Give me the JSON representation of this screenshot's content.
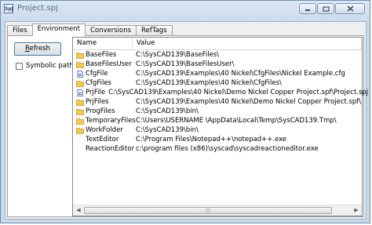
{
  "window": {
    "title": "Project.spj",
    "app_icon": "SpJ"
  },
  "tabs": [
    "Files",
    "Environment",
    "Conversions",
    "RefTags"
  ],
  "left": {
    "refresh_label_first": "R",
    "refresh_label_rest": "efresh",
    "symbolic_paths_label": "Symbolic paths"
  },
  "list": {
    "columns": [
      "Name",
      "Value"
    ],
    "rows": [
      {
        "name": "BaseFiles",
        "value": "C:\\SysCAD139\\BaseFiles\\",
        "icon": "folder-icon"
      },
      {
        "name": "BaseFilesUser",
        "value": "C:\\SysCAD139\\BaseFilesUser\\",
        "icon": "folder-icon"
      },
      {
        "name": "CfgFile",
        "value": "C:\\SysCAD139\\Examples\\40 Nickel\\CfgFiles\\Nickel Example.cfg",
        "icon": "file-icon"
      },
      {
        "name": "CfgFiles",
        "value": "C:\\SysCAD139\\Examples\\40 Nickel\\CfgFiles\\",
        "icon": "folder-icon"
      },
      {
        "name": "PrjFile",
        "value": "C:\\SysCAD139\\Examples\\40 Nickel\\Demo Nickel Copper Project.spf\\Project.spj",
        "icon": "file-icon"
      },
      {
        "name": "PrjFiles",
        "value": "C:\\SysCAD139\\Examples\\40 Nickel\\Demo Nickel Copper Project.spf\\",
        "icon": "folder-icon"
      },
      {
        "name": "ProgFiles",
        "value": "C:\\SysCAD139\\bin\\",
        "icon": "folder-icon"
      },
      {
        "name": "TemporaryFiles",
        "value": "C:\\Users\\USERNAME \\AppData\\Local\\Temp\\SysCAD139.Tmp\\",
        "icon": "folder-icon"
      },
      {
        "name": "WorkFolder",
        "value": "C:\\SysCAD139\\bin\\",
        "icon": "folder-icon"
      },
      {
        "name": "TextEditor",
        "value": "C:\\Program Files\\Notepad++\\notepad++.exe",
        "icon": ""
      },
      {
        "name": "ReactionEditor",
        "value": "c:\\program files (x86)\\syscad\\syscadreactioneditor.exe",
        "icon": ""
      }
    ]
  },
  "colors": {
    "folder": "#f2c94c",
    "folder_edge": "#c9962a",
    "file": "#3a4fa3"
  }
}
